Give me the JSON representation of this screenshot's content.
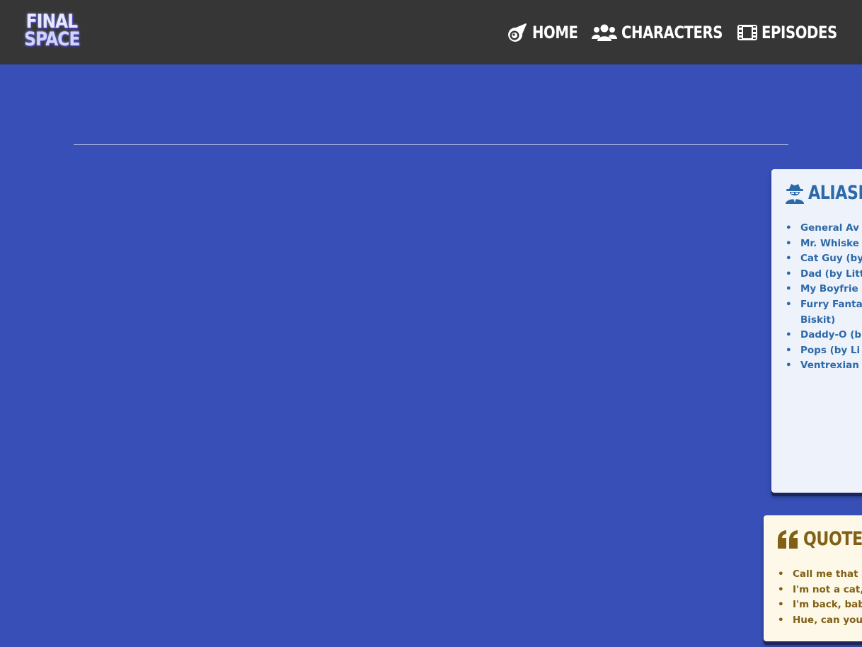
{
  "app": {
    "logo": {
      "line1": "FINAL",
      "line2": "SPACE"
    }
  },
  "nav": {
    "items": [
      {
        "label": "HOME",
        "icon": "comet-icon"
      },
      {
        "label": "CHARACTERS",
        "icon": "users-icon"
      },
      {
        "label": "EPISODES",
        "icon": "film-icon"
      }
    ]
  },
  "aliases": {
    "title": "ALIASE",
    "icon": "user-secret-icon",
    "items": [
      "General Av",
      "Mr. Whiske",
      "Cat Guy (by",
      "Dad (by Littl",
      "My Boyfrie",
      "Furry Fanta Biskit)",
      "Daddy-O (b",
      "Pops (by Li",
      "Ventrexian"
    ]
  },
  "quotes": {
    "title": "QUOTES",
    "icon": "quote-left-icon",
    "items": [
      "Call me that a",
      "I'm not a cat, I'",
      "I'm back, bab",
      "Hue, can you"
    ]
  },
  "colors": {
    "page_bg": "#374fb6",
    "header_bg": "#363636",
    "aliases_bg": "#eef2fb",
    "aliases_text": "#2c69a8",
    "quotes_bg": "#fdf8e8",
    "quotes_text": "#806015"
  }
}
